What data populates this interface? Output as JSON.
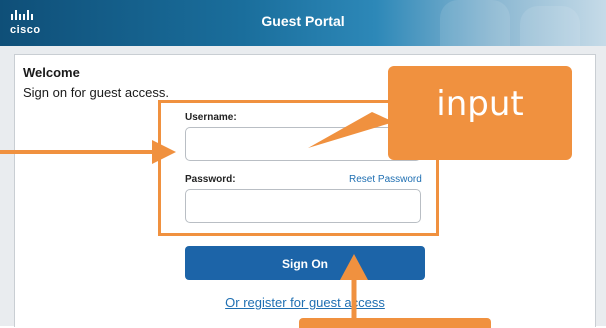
{
  "header": {
    "logo_text": "cisco",
    "title": "Guest Portal"
  },
  "welcome": {
    "heading": "Welcome",
    "subtitle": "Sign on for guest access."
  },
  "form": {
    "username_label": "Username:",
    "username_value": "",
    "password_label": "Password:",
    "password_value": "",
    "reset_password_label": "Reset Password",
    "sign_on_label": "Sign On",
    "register_link": "Or register for guest access"
  },
  "annotations": {
    "input_callout": "input"
  },
  "colors": {
    "header_dark": "#0f4f78",
    "primary_button": "#1c64a8",
    "link": "#1f6fb2",
    "annotation": "#f0913f"
  }
}
